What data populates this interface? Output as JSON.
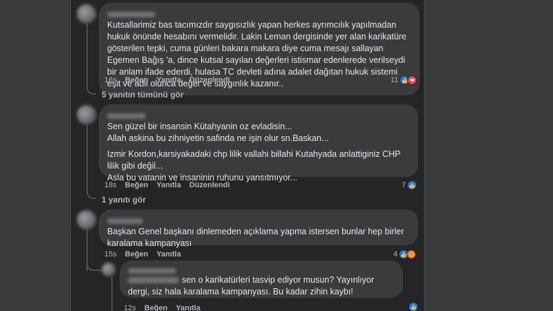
{
  "comments": [
    {
      "text": "Kutsallarimiz bas tacımızdır saygısızlık yapan herkes ayrımcılık yapılmadan hukuk önünde hesabını vermelidir. Lakin Leman dergisinde yer alan karikatüre gösterilen tepki, cuma günleri bakara makara diye cuma mesajı sallayan Egemen Bağış 'a, dince kutsal sayılan değerleri istismar edenlerede verilseydi bir anlam ifade ederdi, hulasa TC devleti adına adalet dağıtan hukuk sistemi eşit ve adil olunca değer ve saygınlık kazanır..",
      "time": "16s",
      "like": "Beğen",
      "reply": "Yanıtla",
      "edited": "Düzenlendi",
      "reaction_count": "11",
      "replies_link": "5 yanıtın tümünü gör"
    },
    {
      "text1": "Sen güzel bir insansin Kütahyanin oz evladisin...\nAllah askina bu zihniyetin safinda ne işin olur sn.Baskan...",
      "text2": "Izmir Kordon,karsiyakadaki chp lilik vallahi billahi Kutahyada anlattiginiz CHP lilik gibi değil...\nAsla bu vatanin ve insaninin ruhunu yansıtmıyor...",
      "time": "18s",
      "like": "Beğen",
      "reply": "Yanıtla",
      "edited": "Düzenlendi",
      "reaction_count": "7",
      "replies_link": "1 yanıtı gör"
    },
    {
      "text": "Başkan Genel başkanı dinlemeden açıklama yapma istersen bunlar hep birler karalama kampanyası",
      "time": "15s",
      "like": "Beğen",
      "reply": "Yanıtla",
      "reaction_count": "4"
    },
    {
      "text": "sen o karikatürleri tasvip ediyor musun? Yayınlıyor dergi, siz hala karalama kampanyası. Bu kadar zihin kaybı!",
      "time": "12s",
      "like": "Beğen",
      "reply": "Yanıtla"
    }
  ],
  "icons": {
    "like": "thumbs-up-icon",
    "love": "heart-icon",
    "angry": "angry-face-icon"
  },
  "colors": {
    "background": "#242526",
    "bubble": "#3a3b3c",
    "like": "#1877f2",
    "love": "#f33e58",
    "angry": "#e9710f"
  }
}
